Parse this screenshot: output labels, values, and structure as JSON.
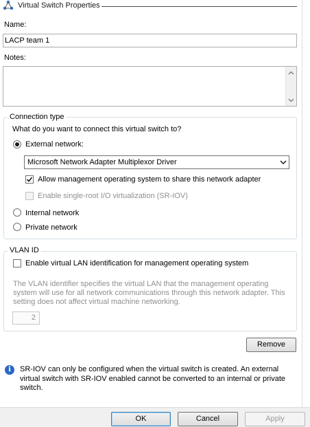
{
  "header": {
    "title": "Virtual Switch Properties",
    "icon": "network-switch-icon"
  },
  "name_field": {
    "label": "Name:",
    "value": "LACP team 1"
  },
  "notes_field": {
    "label": "Notes:",
    "value": ""
  },
  "connection_type": {
    "title": "Connection type",
    "question": "What do you want to connect this virtual switch to?",
    "external": {
      "label": "External network:",
      "checked": true
    },
    "adapter_select": {
      "value": "Microsoft Network Adapter Multiplexor Driver"
    },
    "allow_mgmt": {
      "label": "Allow management operating system to share this network adapter",
      "checked": true
    },
    "sriov": {
      "label": "Enable single-root I/O virtualization (SR-IOV)",
      "checked": false,
      "disabled": true
    },
    "internal": {
      "label": "Internal network",
      "checked": false
    },
    "private": {
      "label": "Private network",
      "checked": false
    }
  },
  "vlan": {
    "title": "VLAN ID",
    "enable_label": "Enable virtual LAN identification for management operating system",
    "description": "The VLAN identifier specifies the virtual LAN that the management operating system will use for all network communications through this network adapter. This setting does not affect virtual machine networking.",
    "id_value": "2"
  },
  "remove_label": "Remove",
  "info_note": "SR-IOV can only be configured when the virtual switch is created. An external virtual switch with SR-IOV enabled cannot be converted to an internal or private switch.",
  "buttons": {
    "ok": "OK",
    "cancel": "Cancel",
    "apply": "Apply"
  },
  "colors": {
    "accent": "#3c7fb1",
    "info": "#2b68c4",
    "disabled_text": "#8f8f8f"
  }
}
